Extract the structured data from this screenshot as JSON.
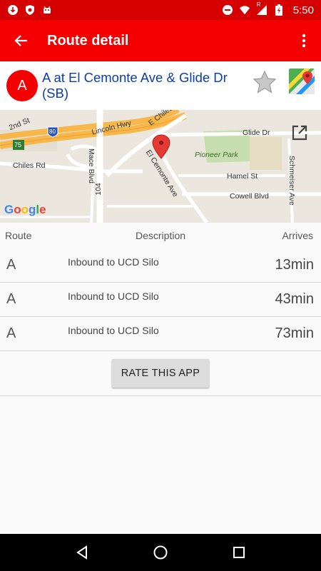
{
  "status_bar": {
    "time": "5:50",
    "left_icons": [
      "download-icon",
      "shield-icon",
      "android-icon"
    ],
    "right_icons": [
      "do-not-disturb-icon",
      "wifi-icon",
      "signal-icon",
      "battery-icon"
    ],
    "signal_label": "R"
  },
  "app_bar": {
    "title": "Route detail",
    "background": "#f40000"
  },
  "stop": {
    "route_badge": "A",
    "name": "A at El Cemonte Ave & Glide Dr (SB)",
    "name_color": "#0d3ea3"
  },
  "map": {
    "labels": {
      "e_chiles": "E Chiles Rd",
      "glide": "Glide Dr",
      "lincoln": "Lincoln Hwy",
      "second_st": "2nd St",
      "mace": "Mace Blvd",
      "el_cemonte": "El Cemonte Ave",
      "pioneer_park": "Pioneer Park",
      "schmeiser": "Schmeiser Ave",
      "chiles": "Chiles Rd",
      "hamel": "Hamel St",
      "cowell": "Cowell Blvd",
      "hwy_104": "104",
      "i80": "80",
      "hwy_75": "75"
    },
    "logo": "Google"
  },
  "table": {
    "headers": {
      "route": "Route",
      "description": "Description",
      "arrives": "Arrives"
    },
    "rows": [
      {
        "route": "A",
        "description": "Inbound to UCD Silo",
        "arrives": "13min"
      },
      {
        "route": "A",
        "description": "Inbound to UCD Silo",
        "arrives": "43min"
      },
      {
        "route": "A",
        "description": "Inbound to UCD Silo",
        "arrives": "73min"
      }
    ]
  },
  "rate_button": "RATE THIS APP"
}
